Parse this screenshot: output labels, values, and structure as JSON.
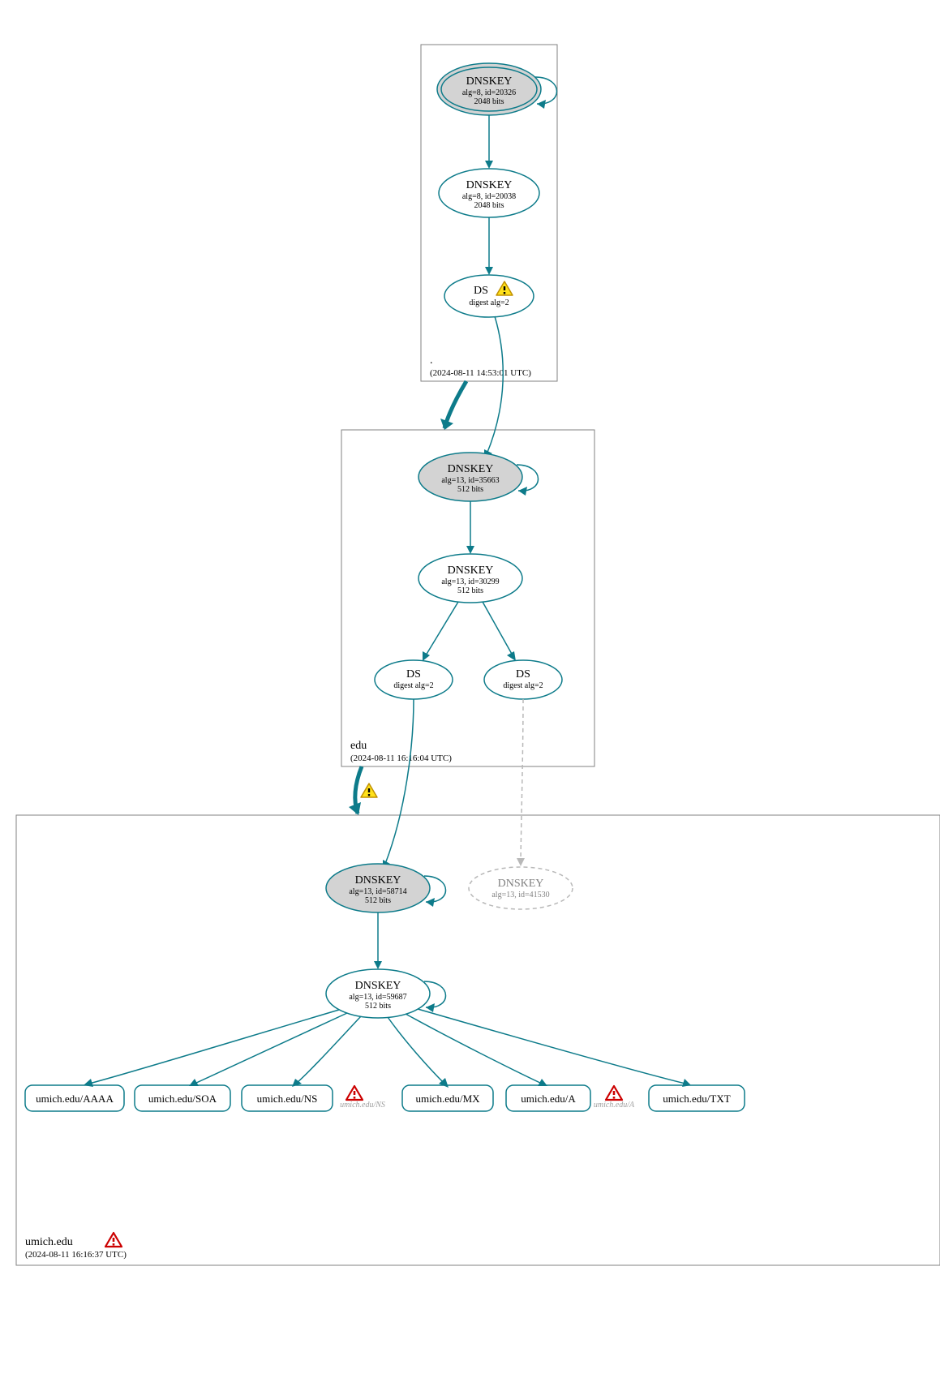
{
  "zones": {
    "root": {
      "name": ".",
      "timestamp": "(2024-08-11 14:53:01 UTC)"
    },
    "edu": {
      "name": "edu",
      "timestamp": "(2024-08-11 16:16:04 UTC)"
    },
    "umich": {
      "name": "umich.edu",
      "timestamp": "(2024-08-11 16:16:37 UTC)"
    }
  },
  "nodes": {
    "root_ksk": {
      "title": "DNSKEY",
      "line1": "alg=8, id=20326",
      "line2": "2048 bits"
    },
    "root_zsk": {
      "title": "DNSKEY",
      "line1": "alg=8, id=20038",
      "line2": "2048 bits"
    },
    "root_ds": {
      "title": "DS",
      "line1": "digest alg=2"
    },
    "edu_ksk": {
      "title": "DNSKEY",
      "line1": "alg=13, id=35663",
      "line2": "512 bits"
    },
    "edu_zsk": {
      "title": "DNSKEY",
      "line1": "alg=13, id=30299",
      "line2": "512 bits"
    },
    "edu_ds1": {
      "title": "DS",
      "line1": "digest alg=2"
    },
    "edu_ds2": {
      "title": "DS",
      "line1": "digest alg=2"
    },
    "umich_ksk": {
      "title": "DNSKEY",
      "line1": "alg=13, id=58714",
      "line2": "512 bits"
    },
    "umich_zsk": {
      "title": "DNSKEY",
      "line1": "alg=13, id=59687",
      "line2": "512 bits"
    },
    "umich_ghost": {
      "title": "DNSKEY",
      "line1": "alg=13, id=41530"
    }
  },
  "rrsets": {
    "aaaa": "umich.edu/AAAA",
    "soa": "umich.edu/SOA",
    "ns": "umich.edu/NS",
    "ns_g": "umich.edu/NS",
    "mx": "umich.edu/MX",
    "a": "umich.edu/A",
    "a_g": "umich.edu/A",
    "txt": "umich.edu/TXT"
  }
}
